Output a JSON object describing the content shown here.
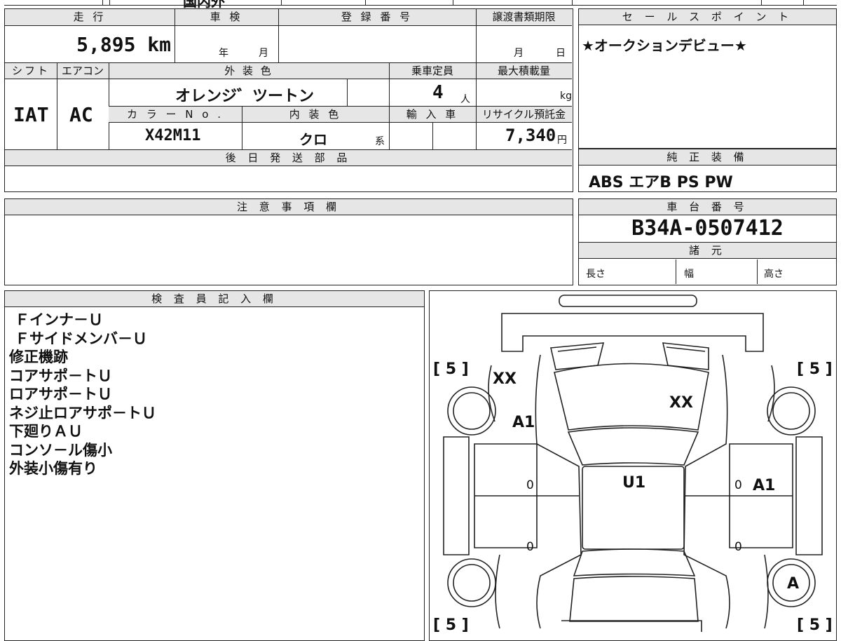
{
  "top_partial_text": "国内外",
  "headers": {
    "mileage": "走 行",
    "inspection": "車 検",
    "registration": "登 録 番 号",
    "transfer_deadline": "譲渡書類期限",
    "sales_point": "セ ー ル ス ポ イ ン ト",
    "shift": "シフト",
    "aircon": "エアコン",
    "exterior_color": "外 装 色",
    "capacity": "乗車定員",
    "max_load": "最大積載量",
    "color_no": "カ ラ ー N o .",
    "interior_color": "内 装 色",
    "import": "輸 入 車",
    "recycle_fee": "リサイクル預託金",
    "later_parts": "後 日 発 送 部 品",
    "equipment": "純 正 装 備",
    "caution": "注 意 事 項 欄",
    "chassis": "車 台 番 号",
    "specs": "諸 元",
    "inspector": "検 査 員 記 入 欄"
  },
  "values": {
    "mileage": "5,895 km",
    "inspection_year": "年",
    "inspection_month": "月",
    "deadline_month": "月",
    "deadline_day": "日",
    "shift": "IAT",
    "aircon": "AC",
    "exterior_color": "オレンジ゛ツートン",
    "capacity": "4",
    "capacity_unit": "人",
    "max_load_unit": "kg",
    "color_no": "X42M11",
    "interior_color": "クロ",
    "interior_suffix": "系",
    "recycle_fee": "7,340",
    "recycle_unit": "円",
    "sales_point": "★オークションデビュー★",
    "equipment": "ABS エアB PS PW",
    "chassis_no": "B34A-0507412",
    "length_label": "長さ",
    "width_label": "幅",
    "height_label": "高さ"
  },
  "inspector_notes": [
    "Ｆインナ－Ｕ",
    "Ｆサイドメンバ－Ｕ",
    "修正機跡",
    "コアサポ－トＵ",
    "ロアサポ－トＵ",
    "ネジ止ロアサポ－トＵ",
    "下廻りＡＵ",
    "コンソ－ル傷小",
    "外装小傷有り"
  ],
  "diagram_marks": {
    "tire_fl": "[ 5 ]",
    "tire_fr": "[ 5 ]",
    "tire_rl": "[ 5 ]",
    "tire_rr": "[ 5 ]",
    "front_left_fender": "XX",
    "hood": "XX",
    "left_a": "A1",
    "roof": "U1",
    "right_a": "A1",
    "rear_right": "A",
    "door_zero_1": "0",
    "door_zero_2": "0",
    "door_zero_3": "0",
    "door_zero_4": "0"
  }
}
